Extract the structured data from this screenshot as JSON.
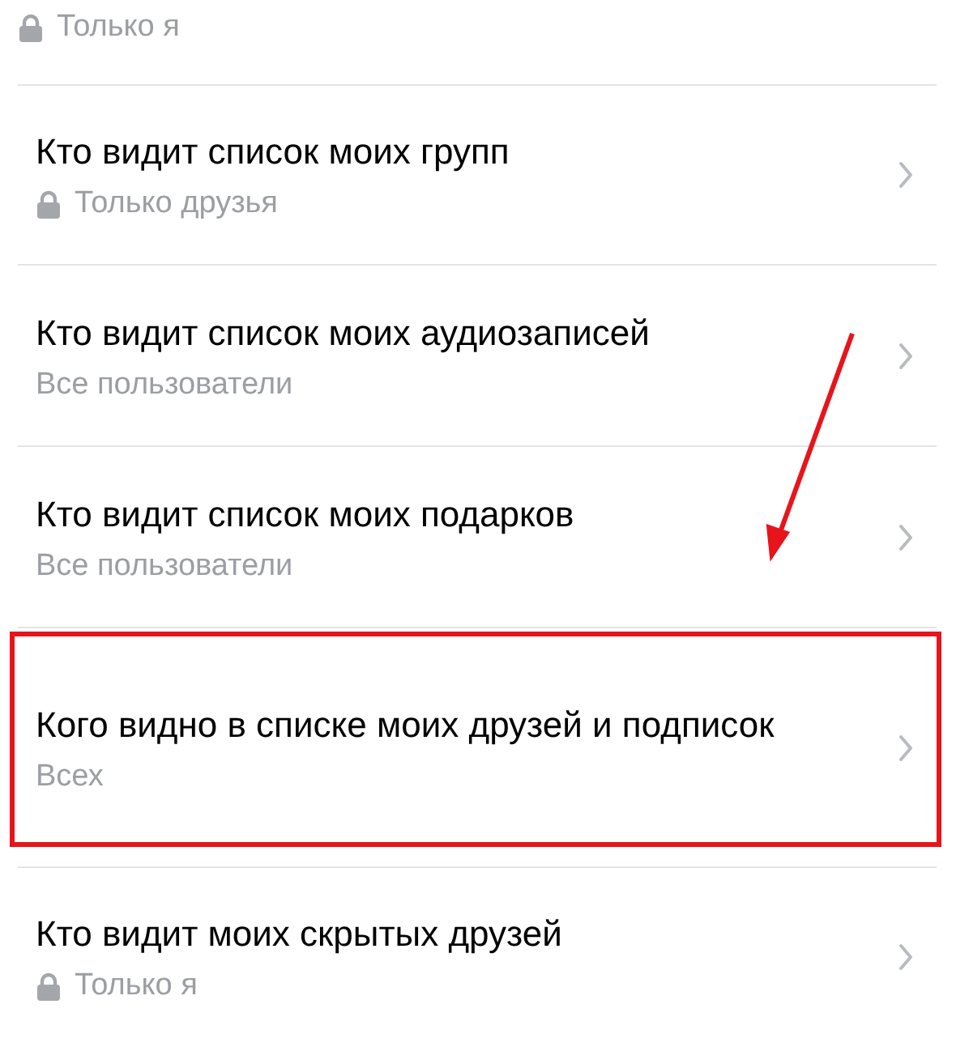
{
  "privacy_settings": [
    {
      "subtitle": "Только я",
      "locked": true,
      "highlighted": false
    },
    {
      "title": "Кто видит список моих групп",
      "subtitle": "Только друзья",
      "locked": true,
      "highlighted": false
    },
    {
      "title": "Кто видит список моих аудиозаписей",
      "subtitle": "Все пользователи",
      "locked": false,
      "highlighted": false
    },
    {
      "title": "Кто видит список моих подарков",
      "subtitle": "Все пользователи",
      "locked": false,
      "highlighted": false
    },
    {
      "title": "Кого видно в списке моих друзей и подписок",
      "subtitle": "Всех",
      "locked": false,
      "highlighted": true
    },
    {
      "title": "Кто видит моих скрытых друзей",
      "subtitle": "Только я",
      "locked": true,
      "highlighted": false
    }
  ]
}
